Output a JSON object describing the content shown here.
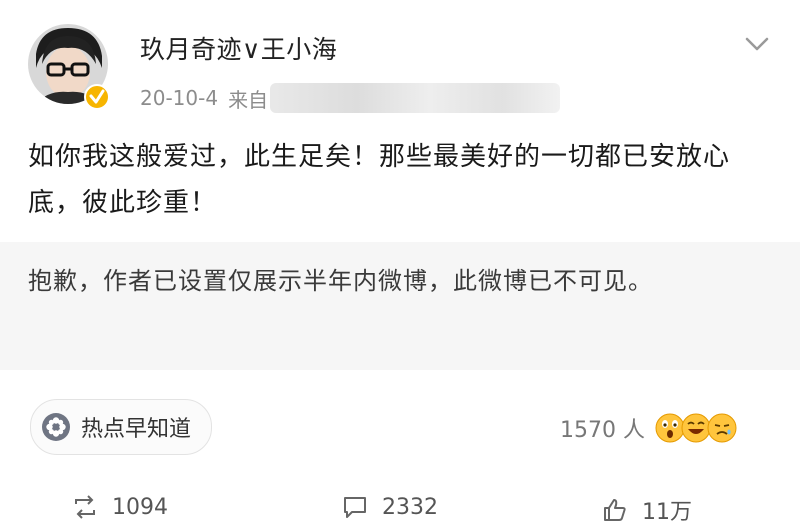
{
  "post": {
    "username": "玖月奇迹∨王小海",
    "date": "20-10-4",
    "source_prefix": "来自",
    "content": "如你我这般爱过，此生足矣！那些最美好的一切都已安放心底，彼此珍重！",
    "notice": "抱歉，作者已设置仅展示半年内微博，此微博已不可见。",
    "topic": {
      "label": "热点早知道",
      "icon": "topic-flower-icon"
    },
    "reactions": {
      "count_label": "1570 人",
      "emojis": [
        "surprised-emoji",
        "laugh-emoji",
        "sad-emoji"
      ]
    }
  },
  "actions": {
    "repost": {
      "label": "1094",
      "icon": "repost-icon"
    },
    "comment": {
      "label": "2332",
      "icon": "comment-icon"
    },
    "like": {
      "label": "11万",
      "icon": "like-icon"
    }
  },
  "colors": {
    "verified": "#f7b500",
    "notice_bg": "#f6f6f6",
    "meta_text": "#8c8c8c"
  }
}
